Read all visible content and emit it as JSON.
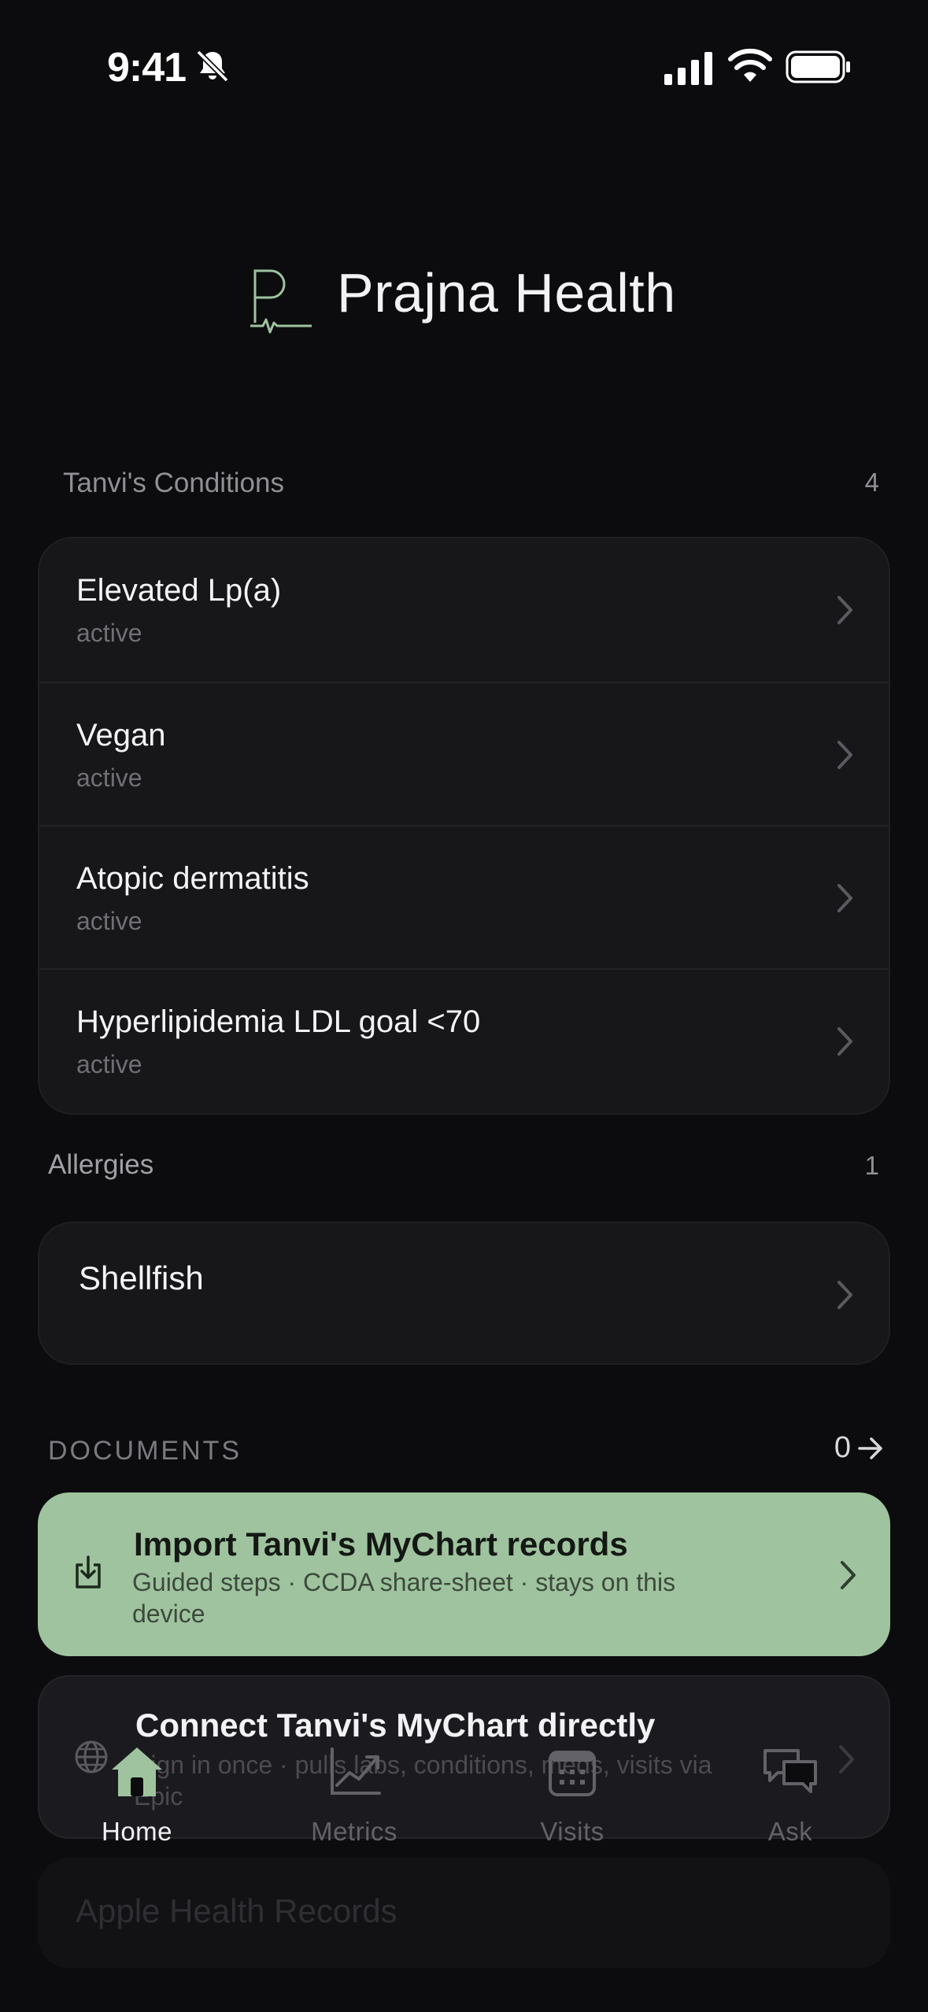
{
  "status_bar": {
    "time": "9:41"
  },
  "header": {
    "app_name": "Prajna Health"
  },
  "conditions": {
    "title": "Tanvi's Conditions",
    "count": "4",
    "items": [
      {
        "name": "Elevated Lp(a)",
        "status": "active"
      },
      {
        "name": "Vegan",
        "status": "active"
      },
      {
        "name": "Atopic dermatitis",
        "status": "active"
      },
      {
        "name": "Hyperlipidemia LDL goal <70",
        "status": "active"
      }
    ]
  },
  "allergies": {
    "title": "Allergies",
    "count": "1",
    "items": [
      {
        "name": "Shellfish"
      }
    ]
  },
  "documents": {
    "title": "DOCUMENTS",
    "count": "0",
    "import": {
      "title": "Import Tanvi's MyChart records",
      "subtitle": "Guided steps · CCDA share-sheet · stays on this device"
    },
    "connect": {
      "title": "Connect Tanvi's MyChart directly",
      "subtitle": "Sign in once · pulls labs, conditions, meds, visits via Epic"
    },
    "apple_health": {
      "title": "Apple Health Records"
    }
  },
  "tab_bar": {
    "tabs": [
      {
        "label": "Home",
        "icon": "house-icon",
        "active": true
      },
      {
        "label": "Metrics",
        "icon": "chart-icon",
        "active": false
      },
      {
        "label": "Visits",
        "icon": "calendar-icon",
        "active": false
      },
      {
        "label": "Ask",
        "icon": "chat-bubbles-icon",
        "active": false
      }
    ]
  },
  "colors": {
    "accent": "#9fc39f",
    "background": "#0c0c0e",
    "card": "#17171a"
  }
}
